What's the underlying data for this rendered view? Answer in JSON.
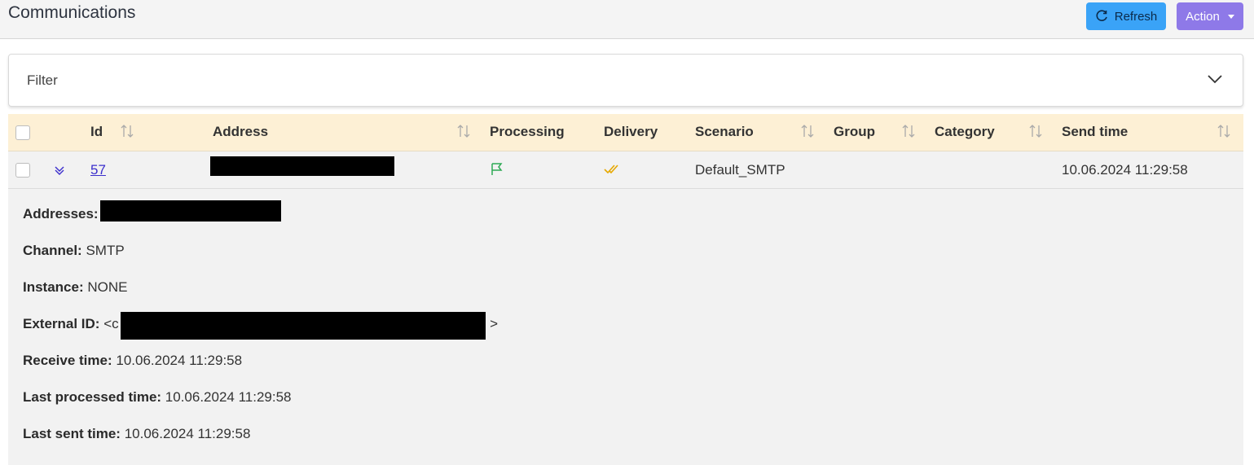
{
  "header": {
    "title": "Communications",
    "refresh_label": "Refresh",
    "action_label": "Action"
  },
  "filter": {
    "label": "Filter"
  },
  "table": {
    "columns": [
      "Id",
      "Address",
      "Processing",
      "Delivery",
      "Scenario",
      "Group",
      "Category",
      "Send time"
    ],
    "rows": [
      {
        "id": "57",
        "address": "[redacted]",
        "processing_icon": "flag-icon",
        "delivery_icon": "double-check-icon",
        "scenario": "Default_SMTP",
        "group": "",
        "category": "",
        "send_time": "10.06.2024 11:29:58"
      }
    ]
  },
  "details": {
    "addresses_label": "Addresses:",
    "addresses_value": "",
    "channel_label": "Channel:",
    "channel_value": "SMTP",
    "instance_label": "Instance:",
    "instance_value": "NONE",
    "external_id_label": "External ID:",
    "external_id_prefix": "<c",
    "external_id_suffix": ">",
    "receive_time_label": "Receive time:",
    "receive_time_value": "10.06.2024 11:29:58",
    "last_processed_label": "Last processed time:",
    "last_processed_value": "10.06.2024 11:29:58",
    "last_sent_label": "Last sent time:",
    "last_sent_value": "10.06.2024 11:29:58"
  },
  "colors": {
    "refresh_button": "#3aa3f7",
    "action_button": "#8e79e8",
    "header_row": "#fdf0d5",
    "processing_flag": "#2eaa55",
    "delivery_check": "#e6a800",
    "link": "#3b2ecc"
  }
}
